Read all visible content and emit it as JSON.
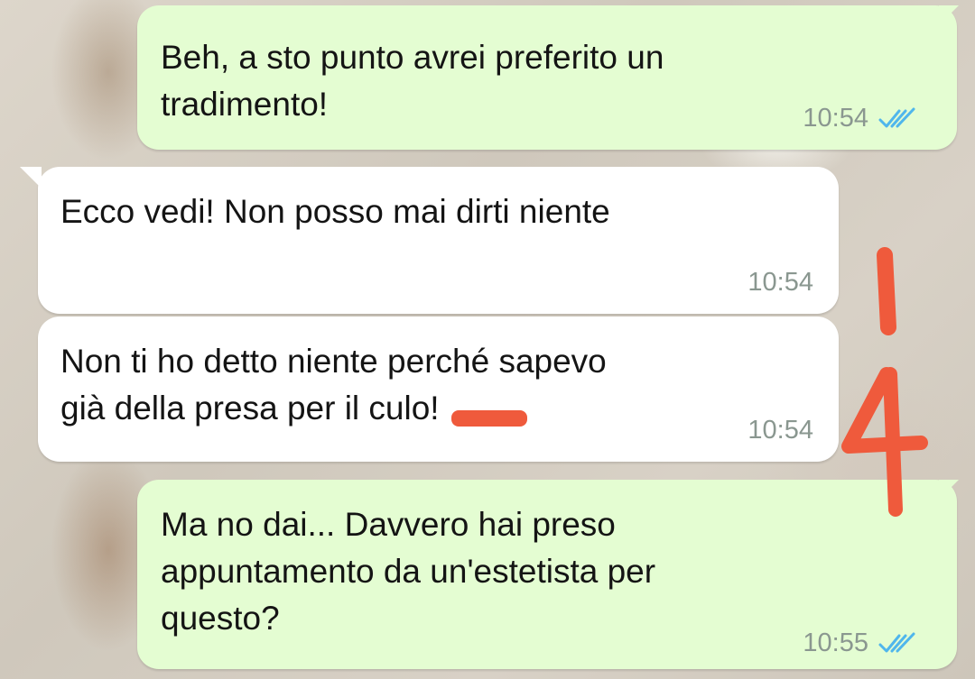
{
  "messages": [
    {
      "direction": "outgoing",
      "text": "Beh, a sto punto avrei preferito un\ntradimento!",
      "time": "10:54",
      "status_icon": "double-check-read-icon"
    },
    {
      "direction": "incoming",
      "text": "Ecco vedi! Non posso mai dirti niente",
      "time": "10:54"
    },
    {
      "direction": "incoming",
      "text": "Non ti ho detto niente perché sapevo\ngià della presa per il culo!",
      "time": "10:54",
      "redaction": "red scribble over a word"
    },
    {
      "direction": "outgoing",
      "text": "Ma no dai... Davvero hai preso\nappuntamento da un'estetista per\nquesto?",
      "time": "10:55",
      "status_icon": "double-check-read-icon"
    }
  ],
  "annotation": {
    "text": "14",
    "color": "#ef5a3c"
  },
  "colors": {
    "outgoing_bubble": "#e4fdd2",
    "incoming_bubble": "#ffffff",
    "read_tick": "#4fb6ec",
    "timestamp": "#8a9790"
  }
}
